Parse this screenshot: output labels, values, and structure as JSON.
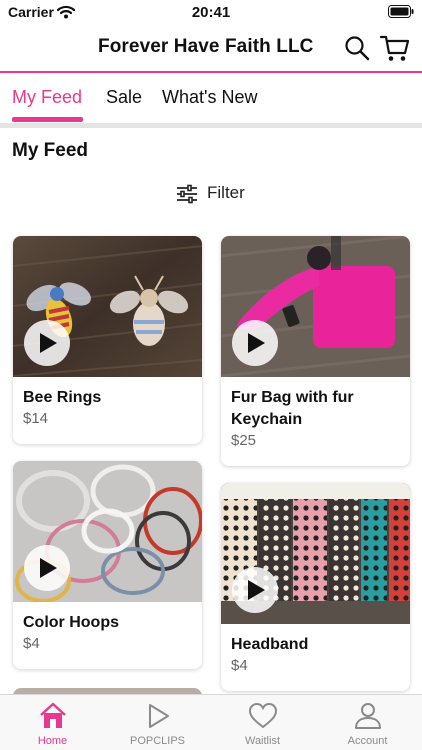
{
  "status_bar": {
    "carrier": "Carrier",
    "time": "20:41"
  },
  "header": {
    "title": "Forever Have Faith LLC",
    "icons": [
      "search-icon",
      "cart-icon"
    ]
  },
  "tabs": [
    {
      "label": "My Feed",
      "active": true
    },
    {
      "label": "Sale",
      "active": false
    },
    {
      "label": "What's New",
      "active": false
    }
  ],
  "section_title": "My Feed",
  "filter": {
    "label": "Filter",
    "icon": "sliders-icon"
  },
  "products": [
    {
      "name": "Bee Rings",
      "price": "$14",
      "has_video": true
    },
    {
      "name": "Fur Bag with fur Keychain",
      "price": "$25",
      "has_video": true
    },
    {
      "name": "Color Hoops",
      "price": "$4",
      "has_video": true
    },
    {
      "name": "Headband",
      "price": "$4",
      "has_video": true
    }
  ],
  "tabbar": [
    {
      "label": "Home",
      "icon": "home-icon",
      "active": true
    },
    {
      "label": "POPCLIPS",
      "icon": "play-icon",
      "active": false
    },
    {
      "label": "Waitlist",
      "icon": "heart-icon",
      "active": false
    },
    {
      "label": "Account",
      "icon": "person-icon",
      "active": false
    }
  ],
  "colors": {
    "accent": "#e8388f",
    "muted": "#8a8a8a"
  }
}
